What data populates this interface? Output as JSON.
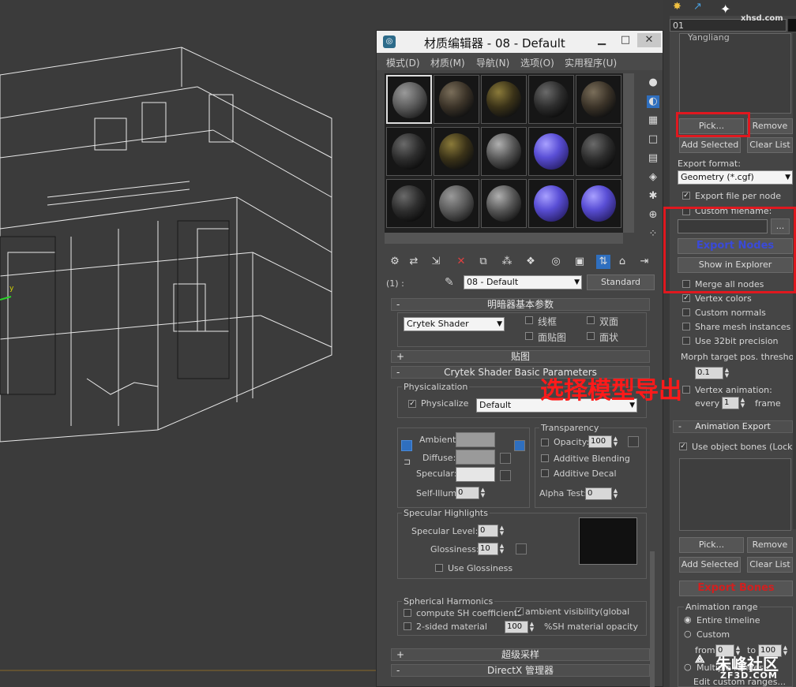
{
  "material_editor": {
    "title": "材质编辑器 - 08 - Default",
    "menu": [
      "模式(D)",
      "材质(M)",
      "导航(N)",
      "选项(O)",
      "实用程序(U)"
    ],
    "slot_label": "(1) :",
    "material_name": "08 - Default",
    "material_type": "Standard",
    "shader_basic": {
      "title": "明暗器基本参数",
      "shader": "Crytek Shader",
      "options": [
        "线框",
        "双面",
        "面贴图",
        "面状"
      ]
    },
    "maps_title": "贴图",
    "crytek_title": "Crytek Shader Basic Parameters",
    "physicalization": {
      "group": "Physicalization",
      "check_label": "Physicalize",
      "value": "Default"
    },
    "colors": {
      "ambient": "Ambient:",
      "diffuse": "Diffuse:",
      "specular": "Specular:",
      "self_illum": "Self-Illum:",
      "self_illum_value": "0"
    },
    "transparency": {
      "group": "Transparency",
      "opacity": "Opacity:",
      "opacity_value": "100",
      "additive_blending": "Additive Blending",
      "additive_decal": "Additive Decal",
      "alpha_test": "Alpha Test:",
      "alpha_value": "0"
    },
    "specular_highlights": {
      "group": "Specular Highlights",
      "level": "Specular Level:",
      "level_value": "0",
      "gloss": "Glossiness:",
      "gloss_value": "10",
      "use_gloss": "Use Glossiness"
    },
    "sh": {
      "group": "Spherical Harmonics",
      "compute": "compute SH coefficients",
      "ambient_vis": "ambient visibility(global",
      "two_sided": "2-sided material",
      "opacity_value": "100",
      "opacity_label": "%SH material opacity"
    },
    "supersampling": "超级采样",
    "directx": "DirectX 管理器"
  },
  "export_panel": {
    "field_value": "01",
    "list_item": "Yangliang",
    "pick": "Pick...",
    "remove": "Remove",
    "add_selected": "Add Selected",
    "clear_list": "Clear List",
    "export_format_label": "Export format:",
    "export_format": "Geometry (*.cgf)",
    "export_file_per_node": "Export file per node",
    "custom_filename": "Custom filename:",
    "browse": "...",
    "export_nodes": "Export Nodes",
    "show_in_explorer": "Show in Explorer",
    "merge_all_nodes": "Merge all nodes",
    "vertex_colors": "Vertex colors",
    "custom_normals": "Custom normals",
    "share_mesh": "Share mesh instances",
    "use_32bit": "Use 32bit precision",
    "morph": "Morph target pos. threshold:",
    "morph_value": "0.1",
    "vertex_anim": "Vertex animation:",
    "every": "every",
    "every_value": "1",
    "frame": "frame",
    "anim_export": "Animation Export",
    "use_object_bones": "Use object bones (Lock)",
    "pick2": "Pick...",
    "remove2": "Remove",
    "add_selected2": "Add Selected",
    "clear_list2": "Clear List",
    "export_bones": "Export Bones",
    "anim_range": "Animation range",
    "entire_timeline": "Entire timeline",
    "custom": "Custom",
    "from": "from",
    "from_value": "0",
    "to": "to",
    "to_value": "100",
    "multiple_ranges": "Multiple ranges",
    "edit_ranges": "Edit custom ranges..."
  },
  "annotation": "选择模型导出",
  "watermarks": {
    "top": "xhsd.com",
    "bottom_cn": "朱峰社区",
    "bottom_en": "ZF3D.COM"
  }
}
